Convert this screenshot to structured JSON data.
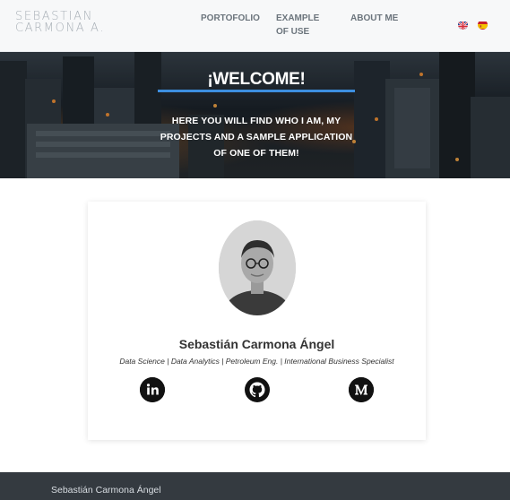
{
  "header": {
    "logo": {
      "line1": "SEBASTIAN",
      "line2": "CARMONA A."
    },
    "nav": [
      {
        "label": "PORTOFOLIO"
      },
      {
        "label": "EXAMPLE OF USE"
      },
      {
        "label": "ABOUT ME"
      }
    ],
    "languages": [
      {
        "icon": "uk-flag-icon"
      },
      {
        "icon": "spain-flag-icon"
      }
    ]
  },
  "hero": {
    "title": "¡WELCOME!",
    "text": "HERE YOU WILL FIND WHO I AM, MY PROJECTS AND A SAMPLE APPLICATION OF ONE OF THEM!",
    "accent_color": "#3d8fe0"
  },
  "profile": {
    "name": "Sebastián Carmona Ángel",
    "tagline": "Data Science | Data Analytics | Petroleum Eng. | International Business Specialist",
    "social": [
      {
        "icon": "linkedin-icon"
      },
      {
        "icon": "github-icon"
      },
      {
        "icon": "medium-icon"
      }
    ]
  },
  "footer": {
    "text": "Sebastián Carmona Ángel",
    "background": "#343a40"
  }
}
